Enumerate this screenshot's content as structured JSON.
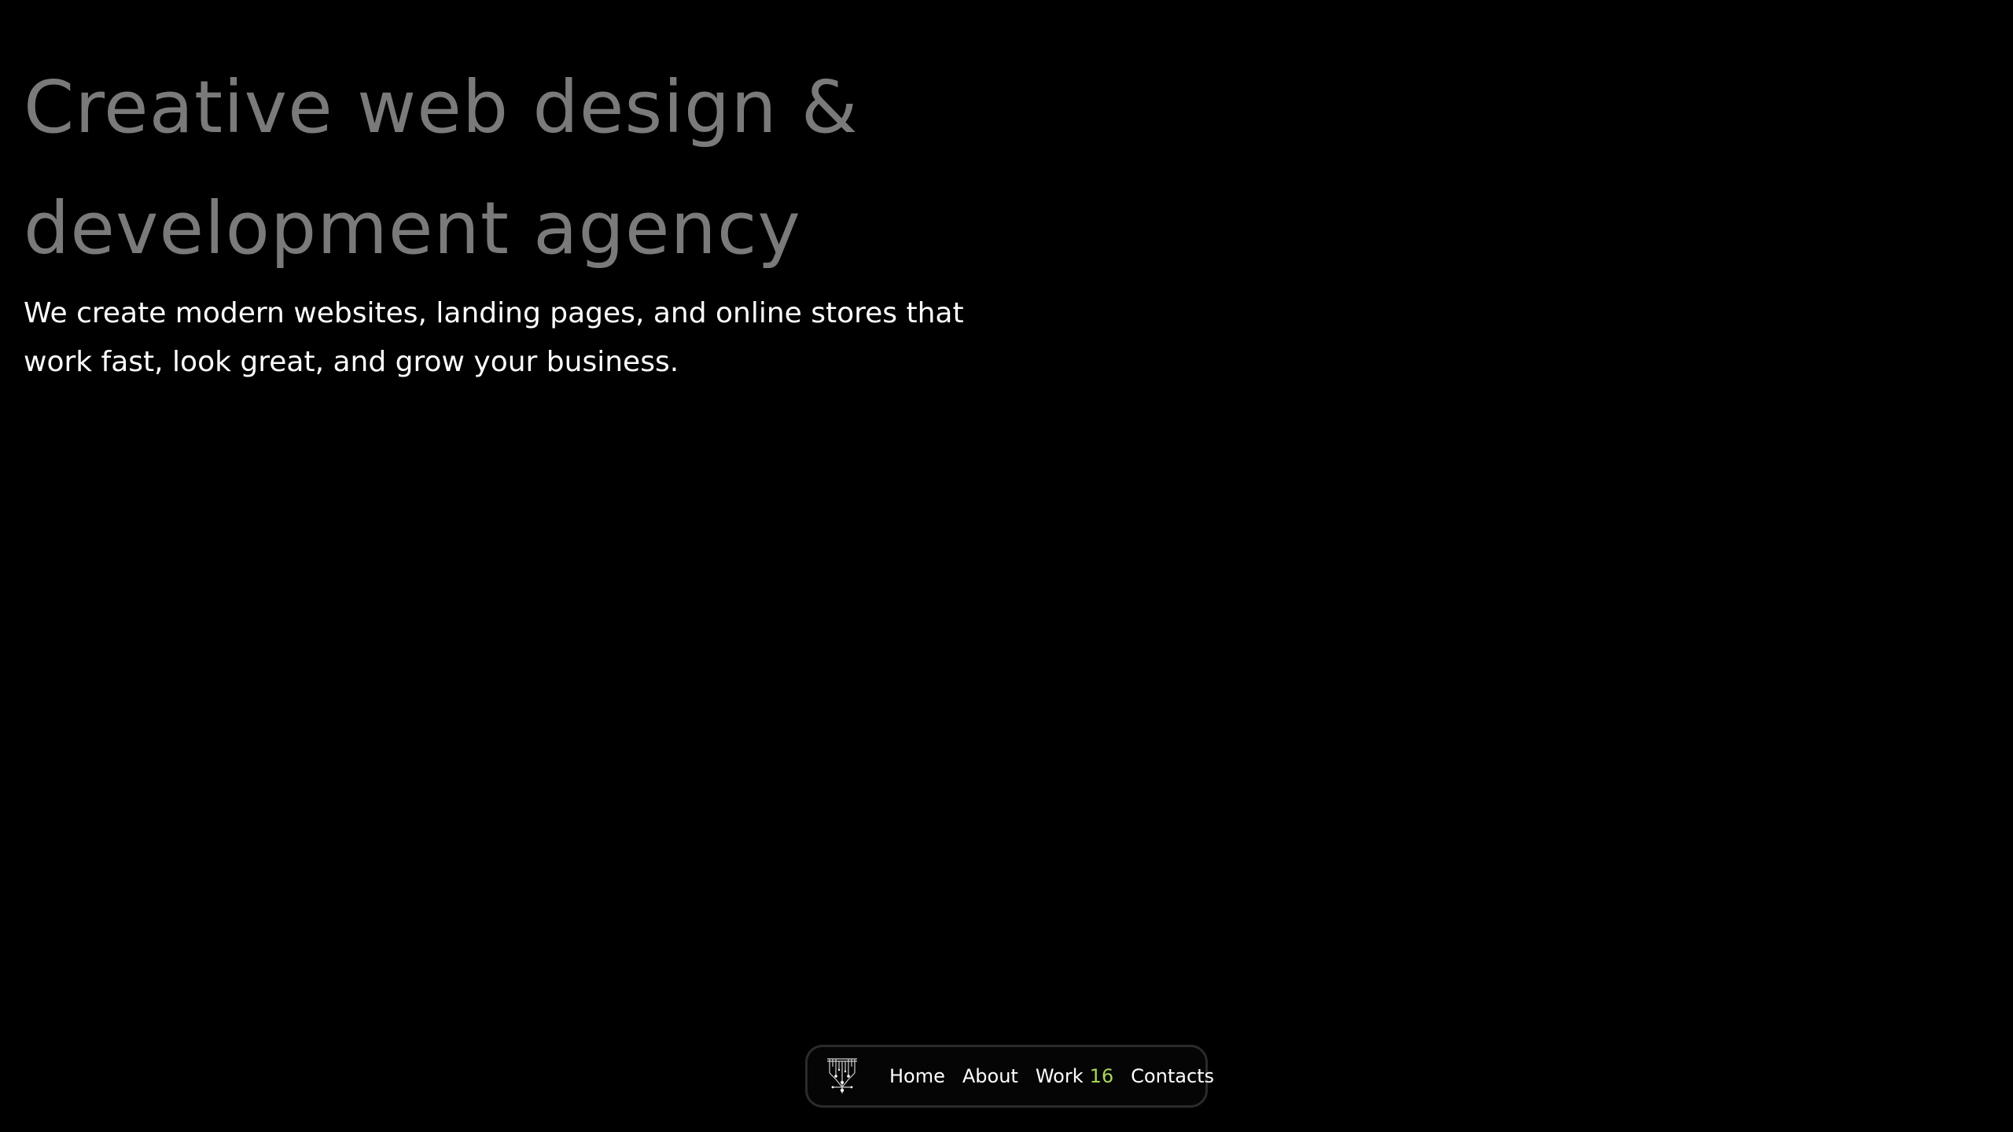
{
  "hero": {
    "title_line1": "Creative web design &",
    "title_line2": "development agency",
    "subtitle_line1": "We create modern websites, landing pages, and online stores that",
    "subtitle_line2": "work fast, look great, and grow your business."
  },
  "nav": {
    "logo_icon": "abstract-mark-icon",
    "items": [
      {
        "label": "Home"
      },
      {
        "label": "About"
      },
      {
        "label": "Work",
        "count": "16"
      },
      {
        "label": "Contacts"
      }
    ]
  },
  "colors": {
    "background": "#000000",
    "title": "#7a7a7a",
    "text": "#ffffff",
    "accent": "#a8d65a",
    "nav_border": "#2b2b2b"
  }
}
